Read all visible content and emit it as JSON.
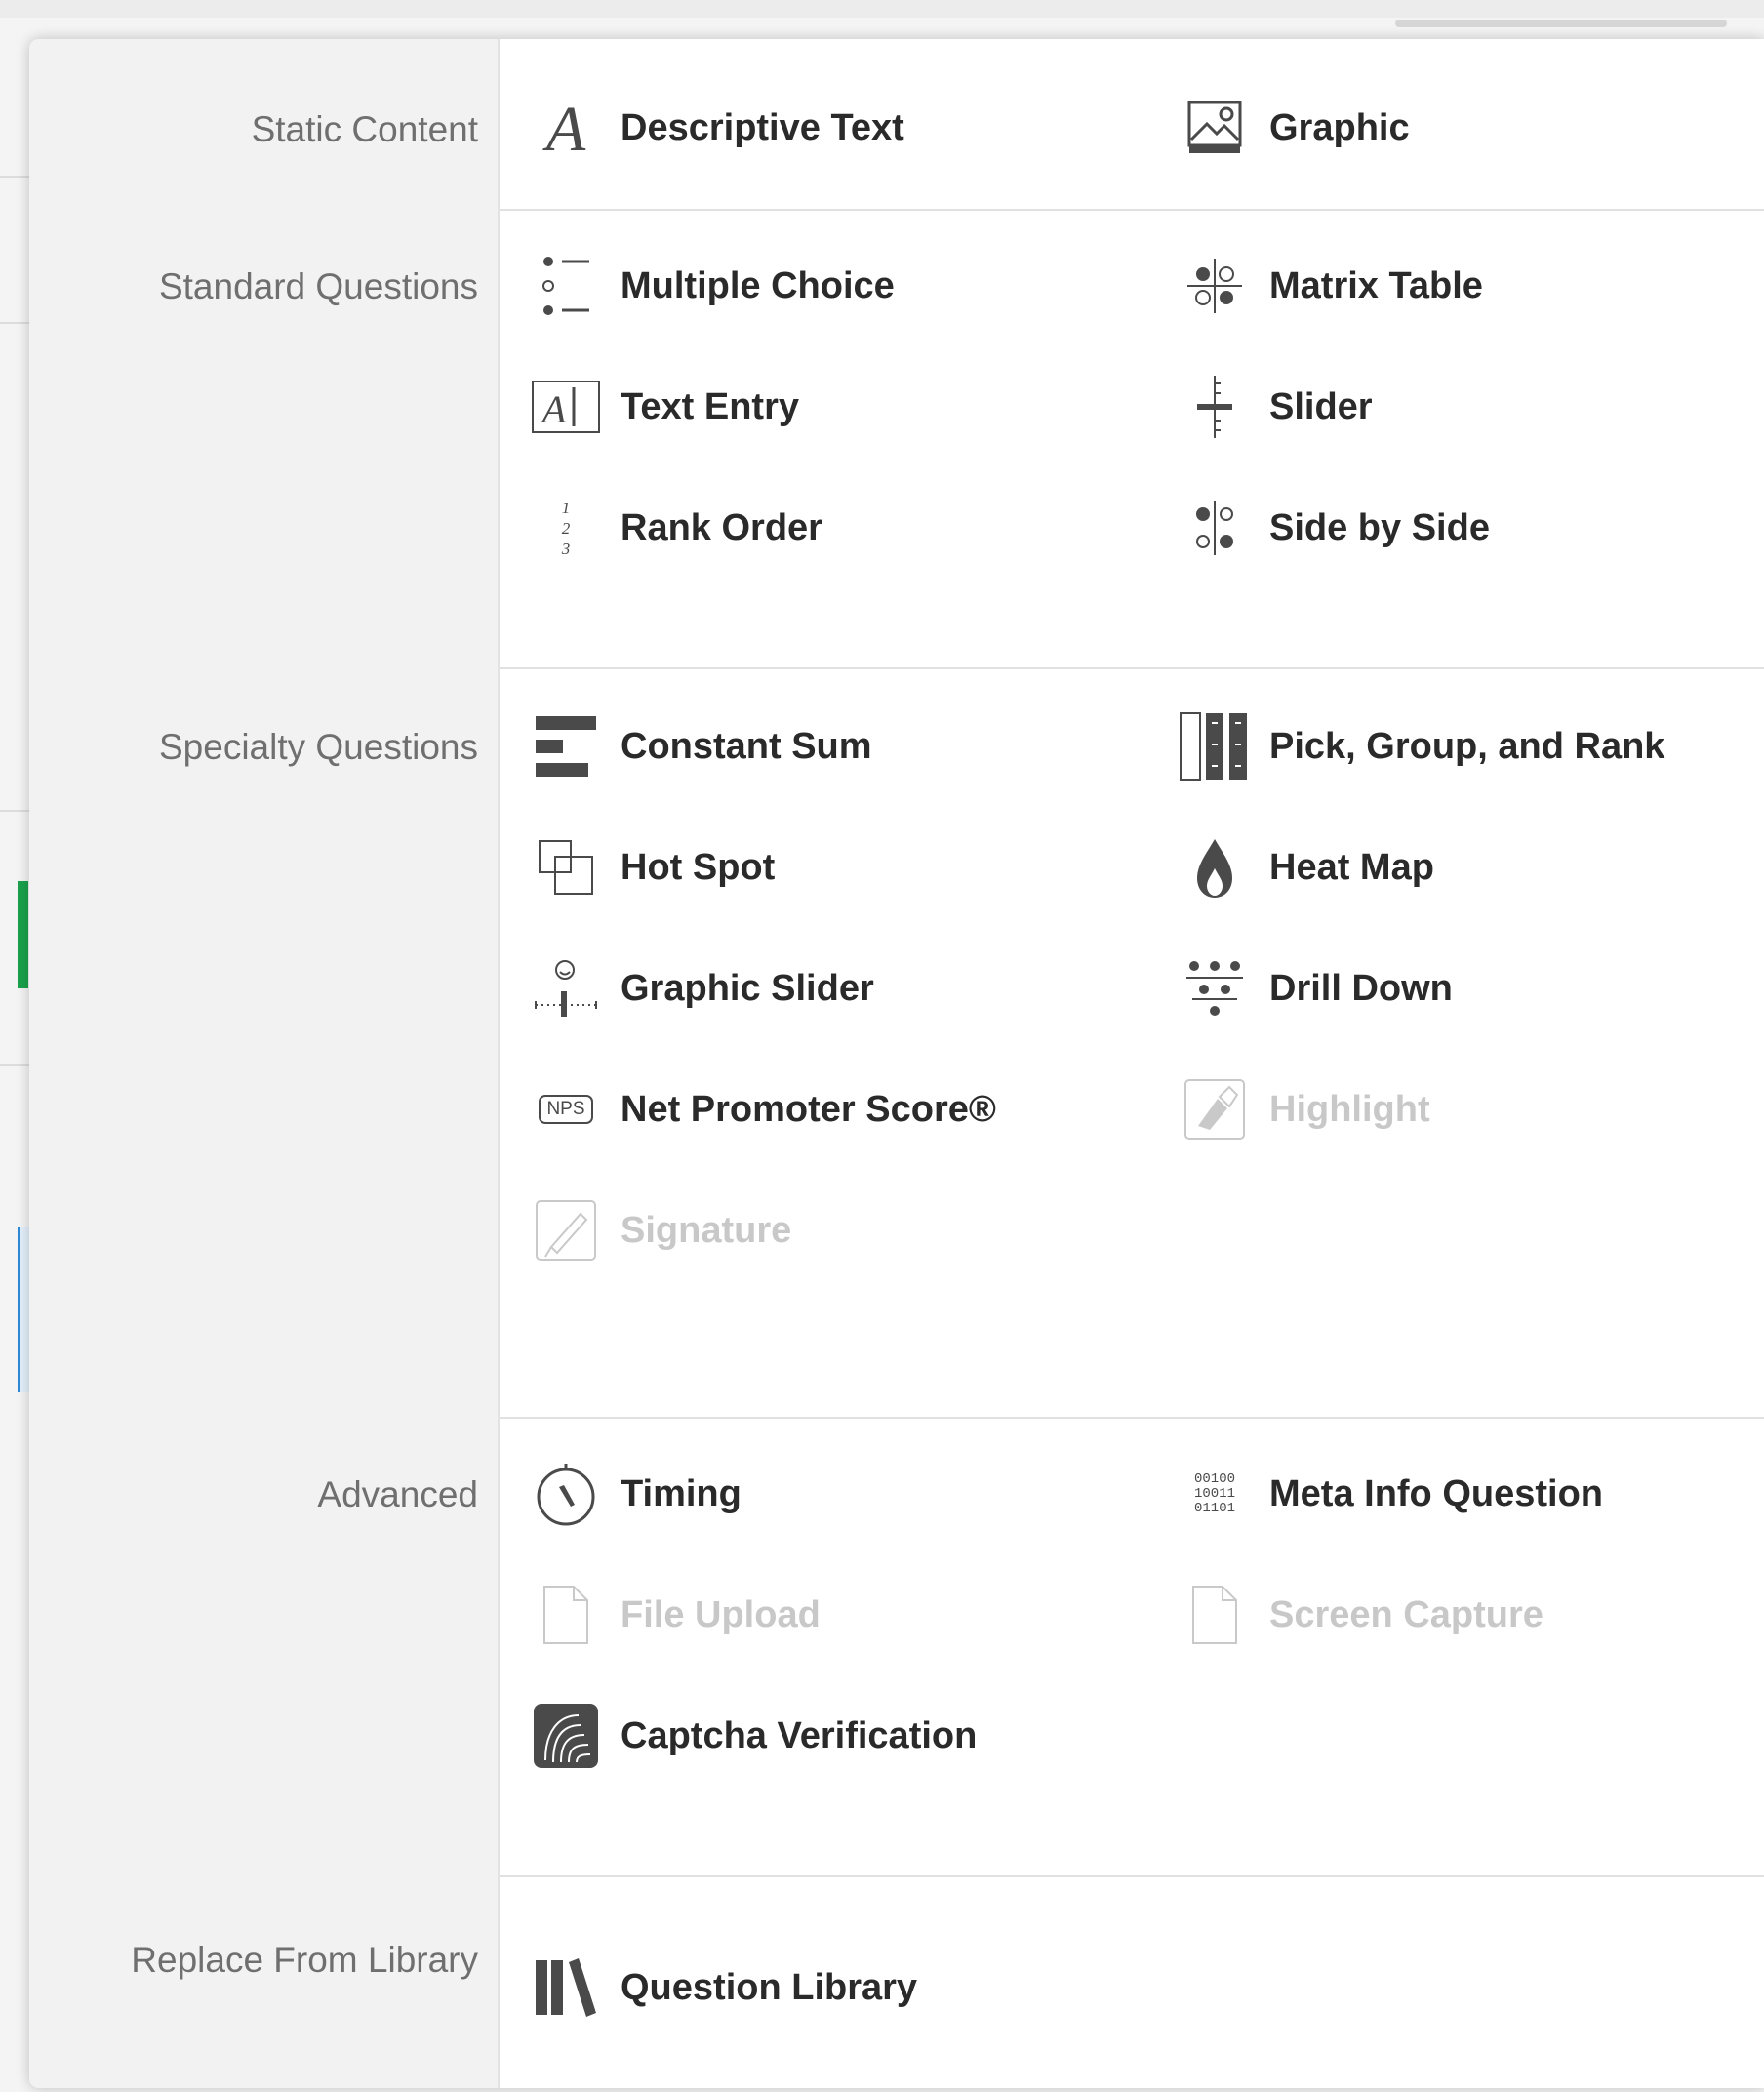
{
  "sections": [
    {
      "title": "Static Content",
      "items": [
        {
          "label": "Descriptive Text",
          "icon": "descriptive-text-icon",
          "disabled": false
        },
        {
          "label": "Graphic",
          "icon": "graphic-icon",
          "disabled": false
        }
      ]
    },
    {
      "title": "Standard Questions",
      "items": [
        {
          "label": "Multiple Choice",
          "icon": "multiple-choice-icon",
          "disabled": false
        },
        {
          "label": "Matrix Table",
          "icon": "matrix-table-icon",
          "disabled": false
        },
        {
          "label": "Text Entry",
          "icon": "text-entry-icon",
          "disabled": false
        },
        {
          "label": "Slider",
          "icon": "slider-icon",
          "disabled": false
        },
        {
          "label": "Rank Order",
          "icon": "rank-order-icon",
          "disabled": false
        },
        {
          "label": "Side by Side",
          "icon": "side-by-side-icon",
          "disabled": false
        }
      ]
    },
    {
      "title": "Specialty Questions",
      "items": [
        {
          "label": "Constant Sum",
          "icon": "constant-sum-icon",
          "disabled": false
        },
        {
          "label": "Pick, Group, and Rank",
          "icon": "pick-group-rank-icon",
          "disabled": false
        },
        {
          "label": "Hot Spot",
          "icon": "hot-spot-icon",
          "disabled": false
        },
        {
          "label": "Heat Map",
          "icon": "heat-map-icon",
          "disabled": false
        },
        {
          "label": "Graphic Slider",
          "icon": "graphic-slider-icon",
          "disabled": false
        },
        {
          "label": "Drill Down",
          "icon": "drill-down-icon",
          "disabled": false
        },
        {
          "label": "Net Promoter Score®",
          "icon": "nps-icon",
          "disabled": false
        },
        {
          "label": "Highlight",
          "icon": "highlight-icon",
          "disabled": true
        },
        {
          "label": "Signature",
          "icon": "signature-icon",
          "disabled": true
        }
      ]
    },
    {
      "title": "Advanced",
      "items": [
        {
          "label": "Timing",
          "icon": "timing-icon",
          "disabled": false
        },
        {
          "label": "Meta Info Question",
          "icon": "meta-info-icon",
          "disabled": false
        },
        {
          "label": "File Upload",
          "icon": "file-upload-icon",
          "disabled": true
        },
        {
          "label": "Screen Capture",
          "icon": "screen-capture-icon",
          "disabled": true
        },
        {
          "label": "Captcha Verification",
          "icon": "captcha-icon",
          "disabled": false
        }
      ]
    },
    {
      "title": "Replace From Library",
      "items": [
        {
          "label": "Question Library",
          "icon": "question-library-icon",
          "disabled": false
        }
      ]
    }
  ],
  "icon_text": {
    "nps": "NPS",
    "meta_bits": [
      "00100",
      "10011",
      "01101"
    ],
    "rank_numbers": [
      "1",
      "2",
      "3"
    ]
  },
  "colors": {
    "label": "#2a2a2a",
    "label_disabled": "#c8c8c8",
    "section_title": "#6f6f6f",
    "sidebar_bg": "#f2f2f2",
    "icon": "#4a4a4a",
    "icon_disabled": "#c9c9c9",
    "accent_green": "#1aa14a"
  }
}
